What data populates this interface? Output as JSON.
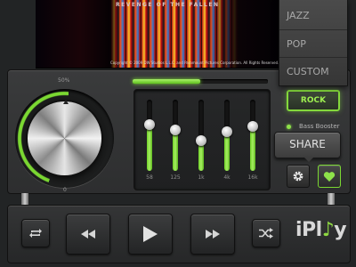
{
  "album": {
    "tagline": "REVENGE OF THE FALLEN",
    "copyright": "Copyright © 2009 DW Studios L.L.C. and Paramount Pictures Corporation. All Rights Reserved."
  },
  "preset_menu": {
    "options": [
      {
        "label": "JAZZ"
      },
      {
        "label": "POP"
      },
      {
        "label": "CUSTOM"
      }
    ]
  },
  "progress": {
    "fraction": 0.5
  },
  "volume": {
    "top_label": "50%",
    "bottom_label": "0",
    "level": 0.5
  },
  "eq": {
    "bands": [
      {
        "label": "58",
        "level": 0.65
      },
      {
        "label": "125",
        "level": 0.58
      },
      {
        "label": "1k",
        "level": 0.42
      },
      {
        "label": "4k",
        "level": 0.55
      },
      {
        "label": "16k",
        "level": 0.62
      }
    ]
  },
  "preset": {
    "selected": "ROCK"
  },
  "bass_booster": {
    "label": "Bass Booster",
    "on": true
  },
  "share": {
    "label": "SHARE"
  },
  "logo": {
    "text_a": "iPl",
    "text_b": "y"
  },
  "colors": {
    "accent_green": "#7bd832",
    "panel_bg": "#2d2e2f"
  }
}
